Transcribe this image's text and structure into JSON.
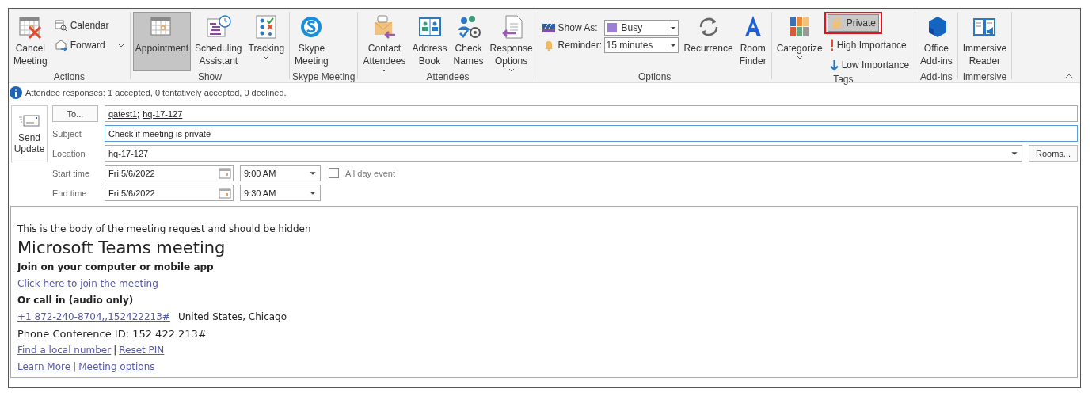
{
  "ribbon": {
    "groups": [
      {
        "label": "Actions",
        "items": [
          {
            "kind": "large",
            "lines": [
              "Cancel",
              "Meeting"
            ],
            "selected": false,
            "dropdown": false
          },
          {
            "kind": "stack",
            "items": [
              {
                "label": "Calendar",
                "selected": false,
                "dropdown": false,
                "annotated": false
              },
              {
                "label": "Forward",
                "selected": false,
                "dropdown": true,
                "annotated": false
              }
            ]
          }
        ]
      },
      {
        "label": "Show",
        "items": [
          {
            "kind": "large",
            "lines": [
              "Appointment"
            ],
            "selected": true,
            "dropdown": false
          },
          {
            "kind": "large",
            "lines": [
              "Scheduling",
              "Assistant"
            ],
            "selected": false,
            "dropdown": false
          },
          {
            "kind": "large",
            "lines": [
              "Tracking"
            ],
            "selected": false,
            "dropdown": true
          }
        ]
      },
      {
        "label": "Skype Meeting",
        "items": [
          {
            "kind": "large",
            "lines": [
              "Skype",
              "Meeting"
            ],
            "selected": false,
            "dropdown": false
          }
        ]
      },
      {
        "label": "Attendees",
        "items": [
          {
            "kind": "large",
            "lines": [
              "Contact",
              "Attendees"
            ],
            "selected": false,
            "dropdown": true
          },
          {
            "kind": "large",
            "lines": [
              "Address",
              "Book"
            ],
            "selected": false,
            "dropdown": false
          },
          {
            "kind": "large",
            "lines": [
              "Check",
              "Names"
            ],
            "selected": false,
            "dropdown": false
          },
          {
            "kind": "large",
            "lines": [
              "Response",
              "Options"
            ],
            "selected": false,
            "dropdown": true
          }
        ]
      },
      {
        "label": "Options",
        "items": [
          {
            "kind": "combos",
            "rows": [
              {
                "label": "Show As:",
                "value": "Busy"
              },
              {
                "label": "Reminder:",
                "value": "15 minutes"
              }
            ]
          },
          {
            "kind": "large",
            "lines": [
              "Recurrence"
            ],
            "selected": false,
            "dropdown": false
          },
          {
            "kind": "large",
            "lines": [
              "Room",
              "Finder"
            ],
            "selected": false,
            "dropdown": false
          }
        ]
      },
      {
        "label": "Tags",
        "items": [
          {
            "kind": "large",
            "lines": [
              "Categorize"
            ],
            "selected": false,
            "dropdown": true
          },
          {
            "kind": "stack",
            "items": [
              {
                "label": "Private",
                "selected": true,
                "dropdown": false,
                "annotated": true
              },
              {
                "label": "High Importance",
                "selected": false,
                "dropdown": false,
                "annotated": false
              },
              {
                "label": "Low Importance",
                "selected": false,
                "dropdown": false,
                "annotated": false
              }
            ]
          }
        ]
      },
      {
        "label": "Add-ins",
        "items": [
          {
            "kind": "large",
            "lines": [
              "Office",
              "Add-ins"
            ],
            "selected": false,
            "dropdown": false
          }
        ]
      },
      {
        "label": "Immersive",
        "items": [
          {
            "kind": "large",
            "lines": [
              "Immersive",
              "Reader"
            ],
            "selected": false,
            "dropdown": false
          }
        ]
      }
    ]
  },
  "info": "Attendee responses: 1 accepted, 0 tentatively accepted, 0 declined.",
  "form": {
    "send_button": [
      "Send",
      "Update"
    ],
    "to_button": "To...",
    "recipients": [
      "qatest1;",
      "hq-17-127"
    ],
    "subject_label": "Subject",
    "subject": "Check if meeting is private",
    "location_label": "Location",
    "location": "hq-17-127",
    "rooms_button": "Rooms...",
    "times": [
      {
        "label": "Start time",
        "date": "Fri 5/6/2022",
        "time": "9:00 AM"
      },
      {
        "label": "End time",
        "date": "Fri 5/6/2022",
        "time": "9:30 AM"
      }
    ],
    "all_day": {
      "label": "All day event",
      "checked": false
    }
  },
  "body": [
    [
      {
        "kind": "text",
        "text": "This is the body of the meeting request and should be hidden"
      }
    ],
    [
      {
        "kind": "heading",
        "text": "Microsoft Teams meeting"
      }
    ],
    [
      {
        "kind": "bold",
        "text": "Join on your computer or mobile app"
      }
    ],
    [
      {
        "kind": "link",
        "text": "Click here to join the meeting"
      }
    ],
    [
      {
        "kind": "bold",
        "text": "Or call in (audio only)"
      }
    ],
    [
      {
        "kind": "link",
        "text": "+1 872-240-8704,,152422213#"
      },
      {
        "kind": "text",
        "text": "United States, Chicago"
      }
    ],
    [
      {
        "kind": "large",
        "text": "Phone Conference ID: 152 422 213#"
      }
    ],
    [
      {
        "kind": "link",
        "text": "Find a local number"
      },
      {
        "kind": "separator",
        "text": "|"
      },
      {
        "kind": "link",
        "text": "Reset PIN"
      }
    ],
    [
      {
        "kind": "link",
        "text": "Learn More"
      },
      {
        "kind": "separator",
        "text": "|"
      },
      {
        "kind": "link",
        "text": "Meeting options"
      }
    ]
  ]
}
